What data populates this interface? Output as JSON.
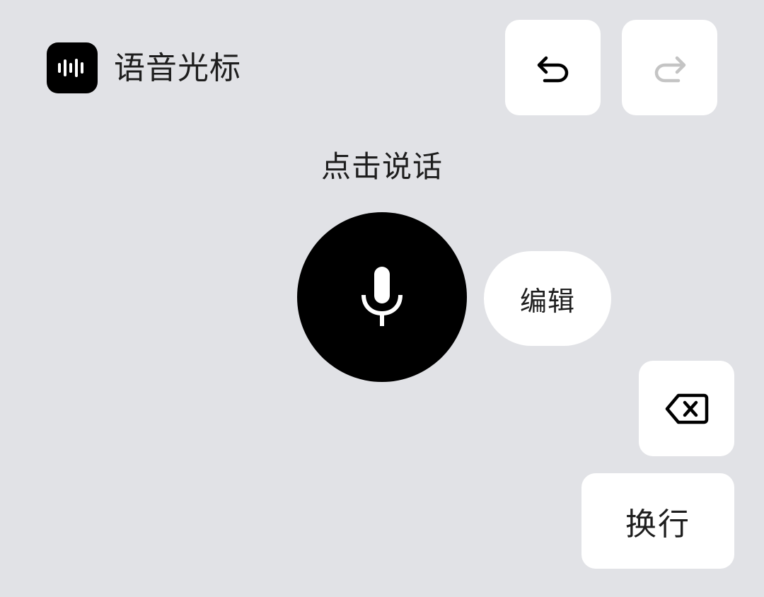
{
  "header": {
    "app_title": "语音光标",
    "app_icon": "waveform-icon"
  },
  "toolbar": {
    "undo_icon": "undo-icon",
    "redo_icon": "redo-icon",
    "redo_enabled": false
  },
  "main": {
    "hint": "点击说话",
    "mic_icon": "microphone-icon",
    "edit_label": "编辑"
  },
  "keys": {
    "backspace_icon": "backspace-icon",
    "newline_label": "换行"
  },
  "colors": {
    "background": "#e1e2e6",
    "tile": "#ffffff",
    "primary": "#000000",
    "text": "#1e1e1e",
    "disabled_icon": "#c4c4c4"
  }
}
